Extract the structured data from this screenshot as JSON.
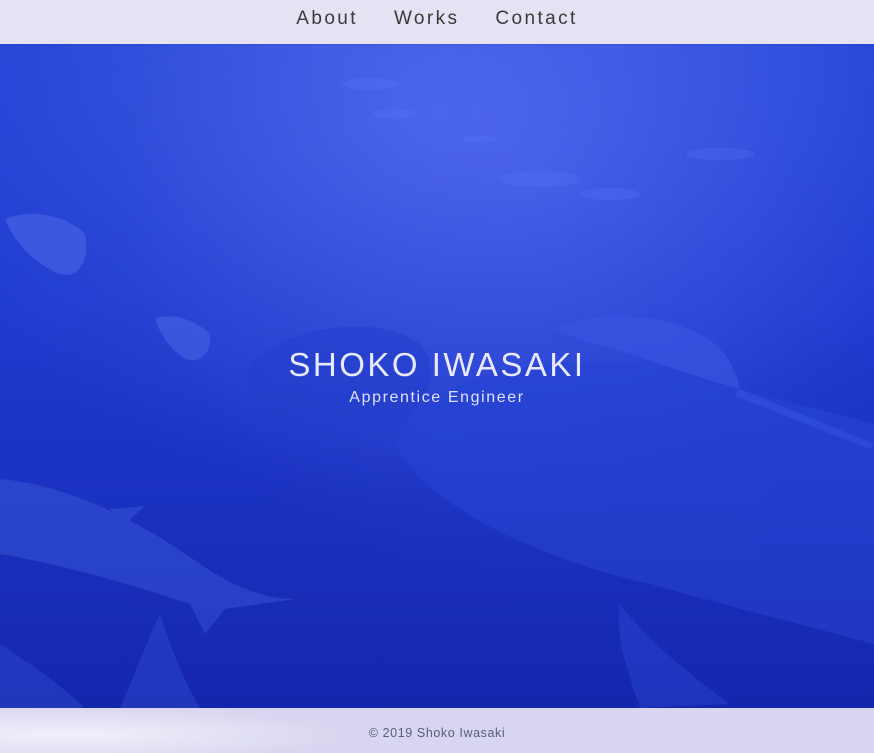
{
  "nav": {
    "items": [
      {
        "label": "About"
      },
      {
        "label": "Works"
      },
      {
        "label": "Contact"
      }
    ]
  },
  "hero": {
    "title": "SHOKO IWASAKI",
    "subtitle": "Apprentice Engineer",
    "background_image": "underwater aquarium scene with whale shark, manta rays and fish",
    "overlay_color": "#1f3bd0"
  },
  "footer": {
    "copyright": "© 2019 Shoko Iwasaki"
  },
  "colors": {
    "nav_bg": "#e5e2f4",
    "nav_text": "#3a3a3a",
    "hero_text": "#e8e9ff",
    "footer_bg": "#d9d7f1",
    "footer_text": "#5b5d7a"
  }
}
